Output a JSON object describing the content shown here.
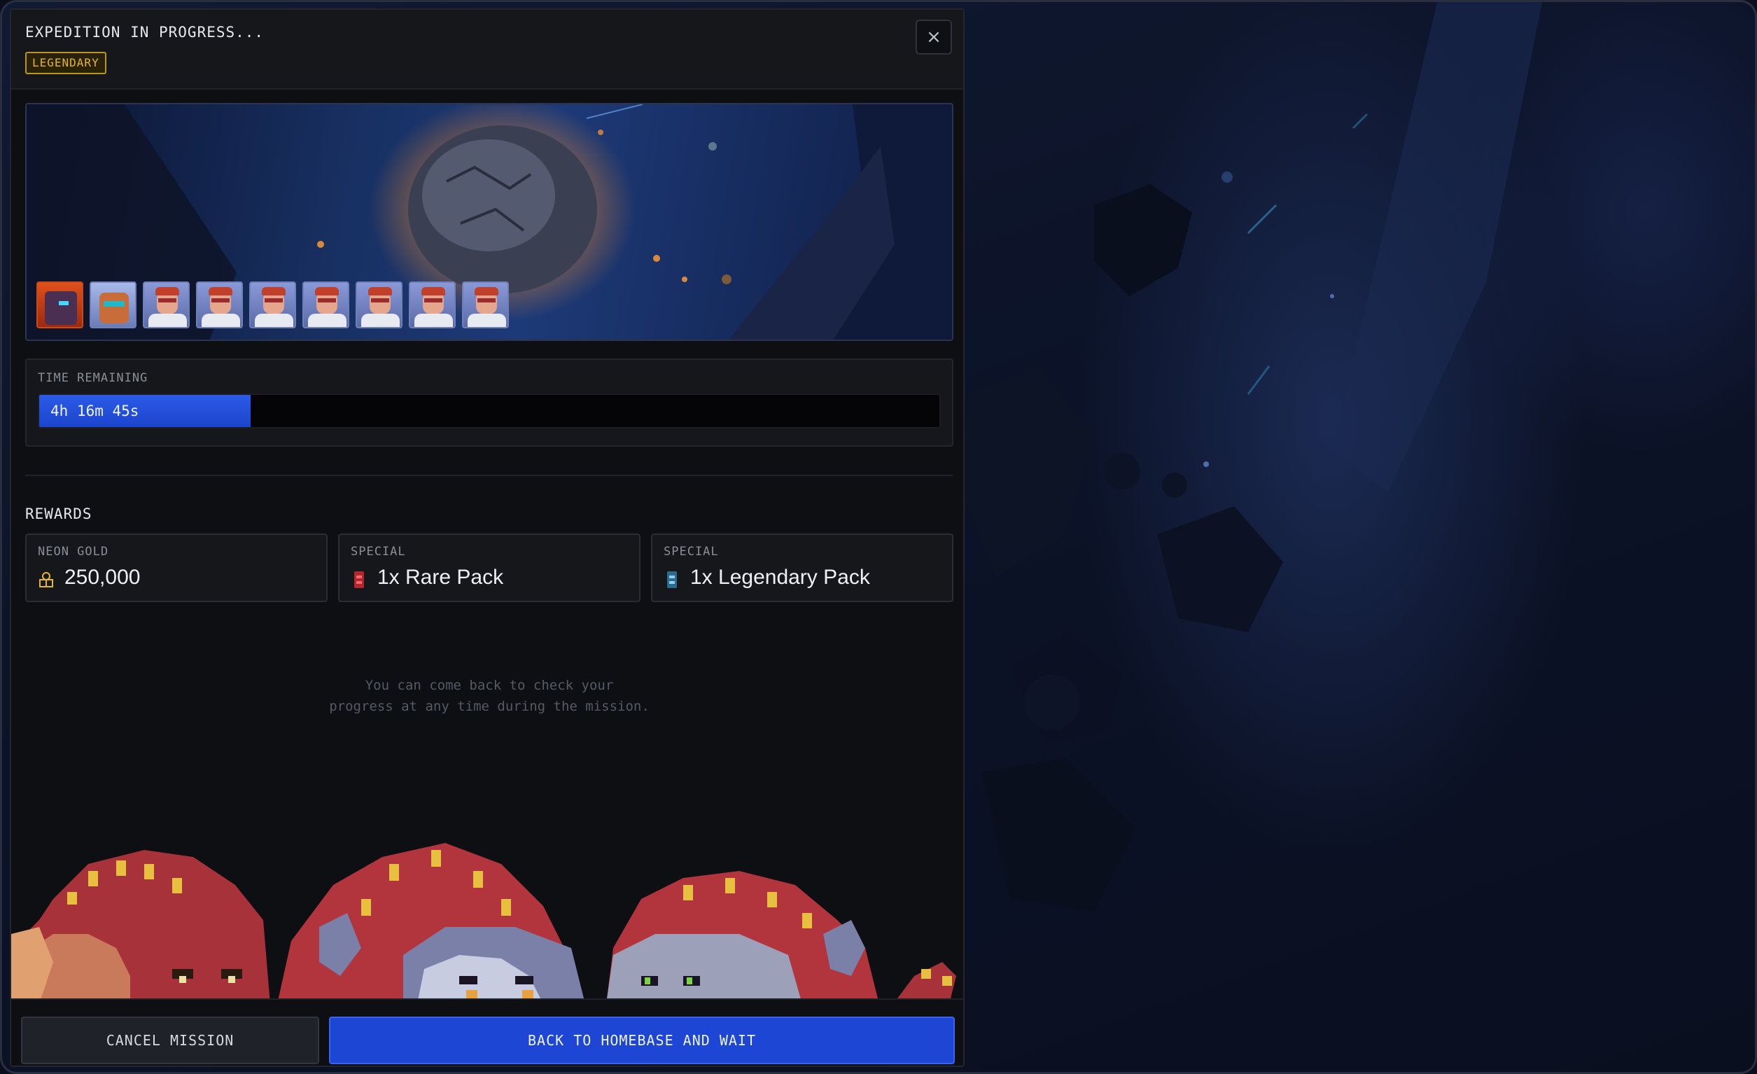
{
  "modal": {
    "title": "EXPEDITION IN PROGRESS...",
    "rarity_badge": "LEGENDARY",
    "close_label": "×"
  },
  "time": {
    "label": "TIME REMAINING",
    "remaining": "4h 16m 45s",
    "progress_percent": 23.5
  },
  "rewards": {
    "title": "REWARDS",
    "items": [
      {
        "type": "NEON GOLD",
        "value": "250,000",
        "icon": "gold-coins-icon",
        "icon_color": "#e3b728"
      },
      {
        "type": "SPECIAL",
        "value": "1x Rare Pack",
        "icon": "rare-pack-icon",
        "icon_color": "#d6303a"
      },
      {
        "type": "SPECIAL",
        "value": "1x Legendary Pack",
        "icon": "legendary-pack-icon",
        "icon_color": "#5aa9d6"
      }
    ]
  },
  "hint": {
    "line1": "You can come back to check your",
    "line2": "progress at any time during the mission."
  },
  "buttons": {
    "cancel": "CANCEL MISSION",
    "back": "BACK TO HOMEBASE AND WAIT"
  },
  "colors": {
    "accent_blue": "#1d46d4",
    "legendary_gold": "#e3b728"
  }
}
